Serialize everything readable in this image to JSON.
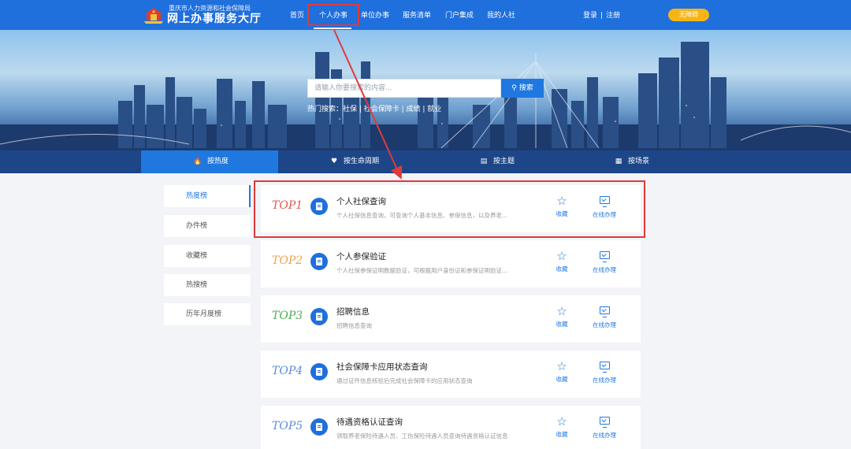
{
  "header": {
    "org": "重庆市人力资源和社会保障局",
    "title": "网上办事服务大厅",
    "nav": [
      "首页",
      "个人办事",
      "单位办事",
      "服务清单",
      "门户集成",
      "我的人社"
    ],
    "login": "登录",
    "register": "注册",
    "auth_sep": "|",
    "accessibility": "无障碍"
  },
  "banner": {
    "search_placeholder": "请输入你要搜索的内容...",
    "search_button": "搜索",
    "hot_search": "热门搜索：社保 | 社会保障卡 | 成绩 | 就业"
  },
  "tabs": [
    "按热度",
    "按生命周期",
    "按主题",
    "按场景"
  ],
  "side_menu": [
    "热度榜",
    "办件榜",
    "收藏榜",
    "热搜榜",
    "历年月度榜"
  ],
  "ranks": [
    {
      "rank": "TOP1",
      "color": "#e8574b",
      "name": "个人社保查询",
      "desc": "个人社保信息查询，可查询个人基本信息、参保信息，以及养老..."
    },
    {
      "rank": "TOP2",
      "color": "#f0a44a",
      "name": "个人参保验证",
      "desc": "个人社保参保证明数据验证，可根据用户身份证和参保证明验证..."
    },
    {
      "rank": "TOP3",
      "color": "#4cae4f",
      "name": "招聘信息",
      "desc": "招聘信息查询"
    },
    {
      "rank": "TOP4",
      "color": "#5b8de0",
      "name": "社会保障卡应用状态查询",
      "desc": "通过证件信息核验后完成社会保障卡的应用状态查询"
    },
    {
      "rank": "TOP5",
      "color": "#5b8de0",
      "name": "待遇资格认证查询",
      "desc": "领取养老保险待遇人员、工伤保险待遇人员查询待遇资格认证信息"
    }
  ],
  "card_actions": {
    "favorite": "收藏",
    "online": "在线办理"
  },
  "colors": {
    "primary": "#1f6fdc",
    "highlight": "#e03a3a",
    "accent": "#f7b515"
  }
}
